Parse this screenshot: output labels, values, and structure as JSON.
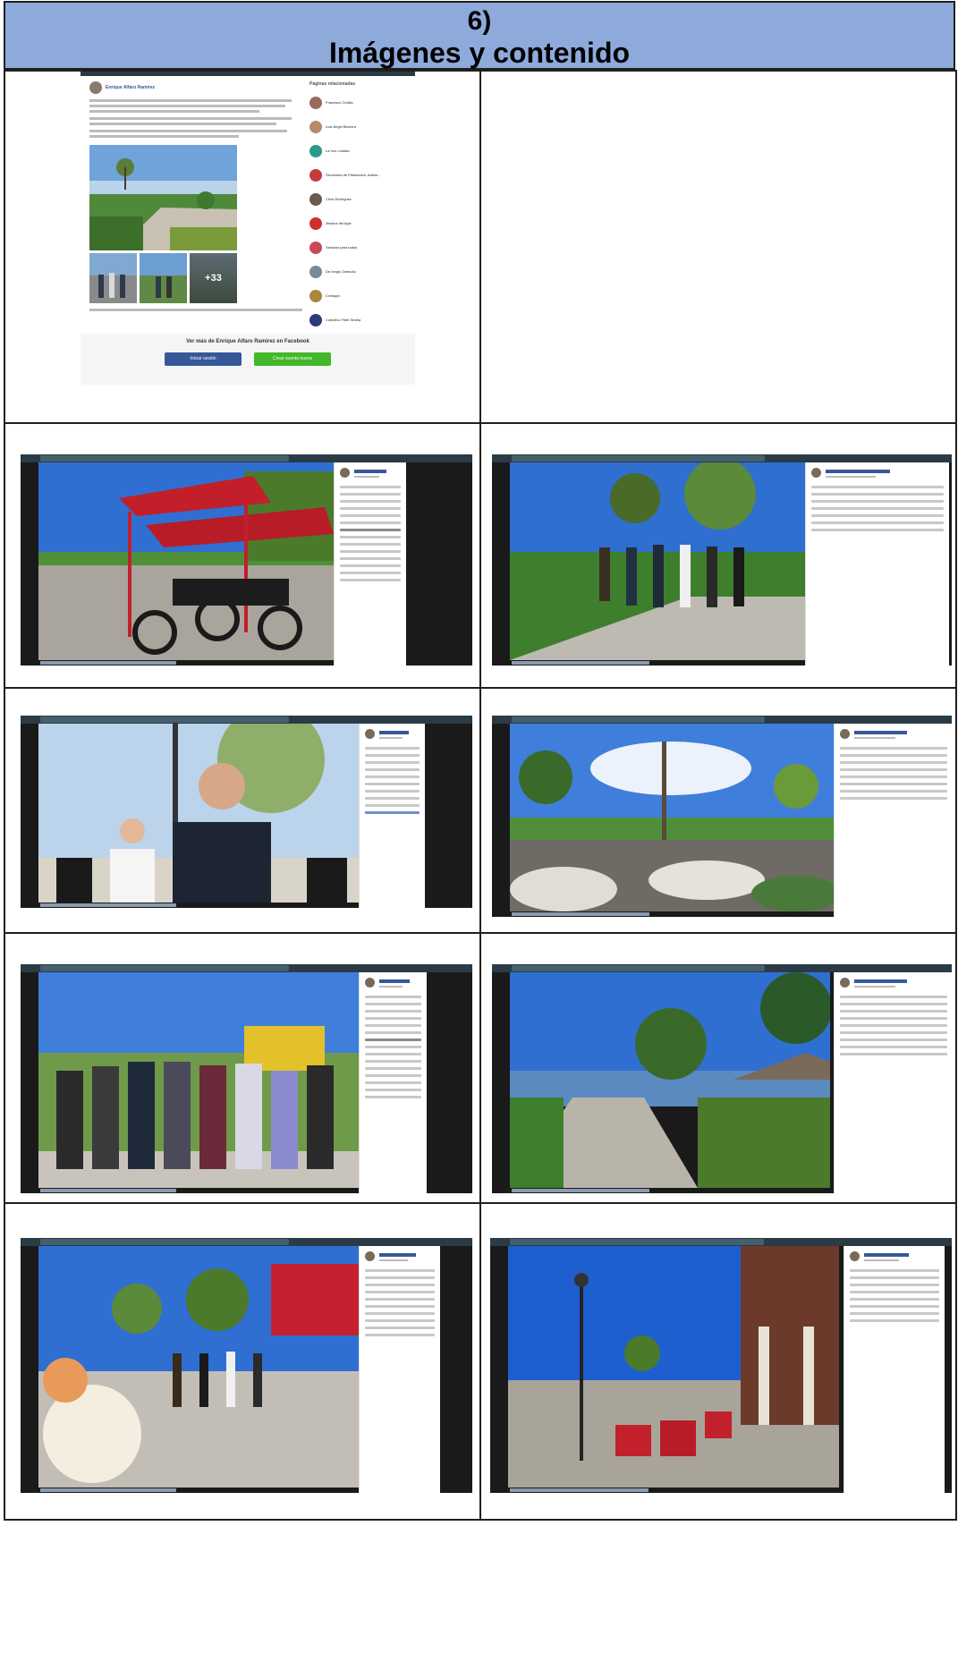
{
  "section": {
    "number": "6)",
    "title": "Imágenes y contenido"
  },
  "facebook_post": {
    "author": "Enrique Alfaro Ramírez",
    "more_from_label": "Ver más de Enrique Alfaro Ramírez en Facebook",
    "login_label": "Iniciar sesión",
    "signup_label": "Crear cuenta nueva",
    "photo_count_label": "+33",
    "suggested_pages_heading": "Páginas relacionadas",
    "suggested_pages": [
      "Francisco Cedillo",
      "Luis Ángel Becerra",
      "La Voz Lealtad",
      "Secretaría de Planeación, Admin...",
      "Chris Rodríguez",
      "Jessica del Ayar",
      "Senador para todos",
      "De Inegio Zamudio",
      "Cvinagro",
      "Colectivo Fidel Sevilla"
    ]
  },
  "colors": {
    "header_fill": "#8eaadb",
    "grid_border": "#1f1f1f",
    "fb_blue": "#365899",
    "fb_green": "#42b72a",
    "viewer_dark": "#1a1a1a"
  }
}
